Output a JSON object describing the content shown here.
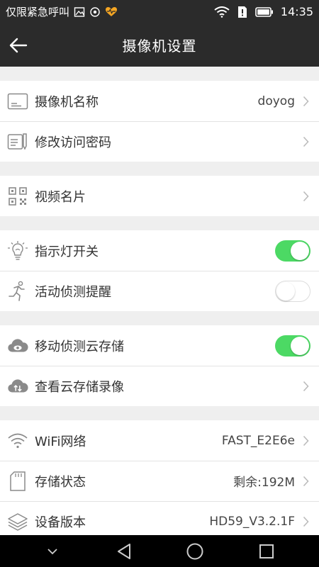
{
  "status_bar": {
    "carrier_text": "仅限紧急呼叫",
    "time": "14:35"
  },
  "app_bar": {
    "title": "摄像机设置",
    "back_icon": "arrow-left-icon"
  },
  "groups": [
    [
      {
        "label": "摄像机名称",
        "value": "doyog",
        "control": "chevron",
        "icon": "id-card-icon"
      },
      {
        "label": "修改访问密码",
        "value": "",
        "control": "chevron",
        "icon": "password-edit-icon"
      }
    ],
    [
      {
        "label": "视频名片",
        "value": "",
        "control": "chevron",
        "icon": "qr-code-icon"
      }
    ],
    [
      {
        "label": "指示灯开关",
        "value": "",
        "control": "switch",
        "switch_on": true,
        "icon": "light-bulb-icon"
      },
      {
        "label": "活动侦测提醒",
        "value": "",
        "control": "switch",
        "switch_on": false,
        "icon": "running-person-icon"
      }
    ],
    [
      {
        "label": "移动侦测云存储",
        "value": "",
        "control": "switch",
        "switch_on": true,
        "icon": "cloud-eye-icon"
      },
      {
        "label": "查看云存储录像",
        "value": "",
        "control": "chevron",
        "icon": "cloud-sync-icon"
      }
    ],
    [
      {
        "label": "WiFi网络",
        "value": "FAST_E2E6e",
        "control": "chevron",
        "icon": "wifi-icon"
      },
      {
        "label": "存储状态",
        "value": "剩余:192M",
        "control": "chevron",
        "icon": "sd-card-icon"
      },
      {
        "label": "设备版本",
        "value": "HD59_V3.2.1F",
        "control": "chevron",
        "icon": "layers-icon"
      }
    ]
  ],
  "colors": {
    "bar_bg": "#2b2b2b",
    "switch_on": "#4cd964",
    "page_bg": "#efefef"
  }
}
